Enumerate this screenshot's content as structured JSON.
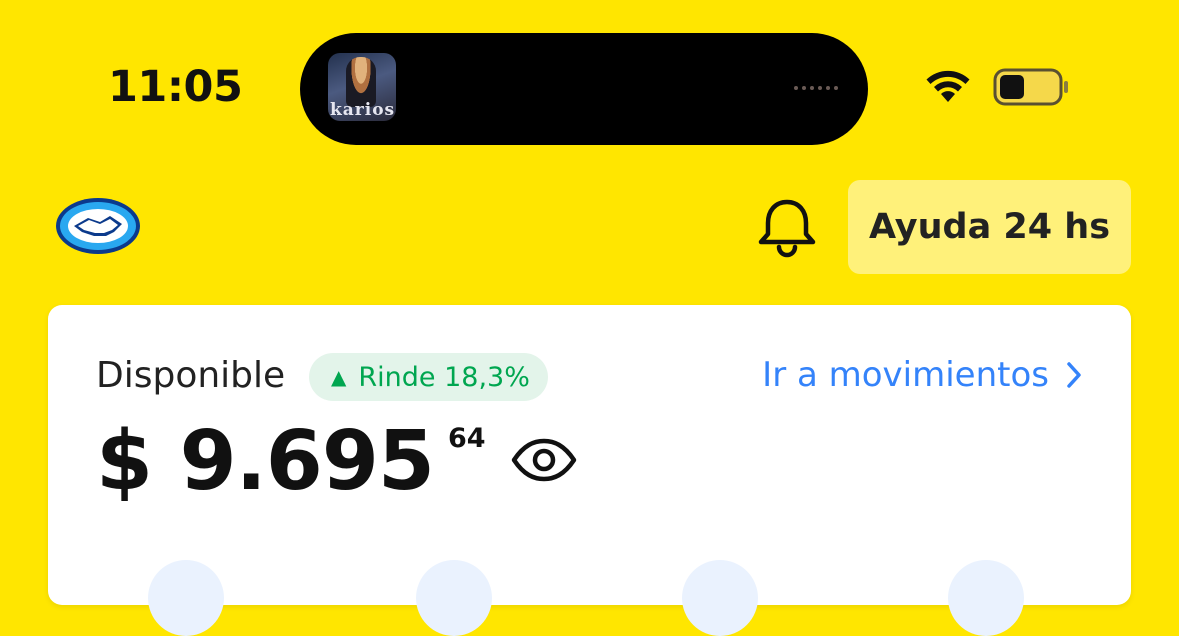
{
  "status_bar": {
    "time": "11:05",
    "now_playing_art_text": "karios"
  },
  "header": {
    "help_label": "Ayuda 24 hs"
  },
  "account_card": {
    "label": "Disponible",
    "yield_badge": "Rinde 18,3%",
    "movements_link": "Ir a movimientos",
    "balance_main": "$ 9.695",
    "balance_cents": "64"
  },
  "colors": {
    "background": "#ffe600",
    "accent_blue": "#3483fa",
    "positive_green": "#00a650",
    "help_button": "#fff17a"
  },
  "icons": [
    "wifi-icon",
    "battery-icon",
    "mercadopago-logo",
    "bell-icon",
    "arrow-up-icon",
    "chevron-right-icon",
    "eye-icon"
  ]
}
